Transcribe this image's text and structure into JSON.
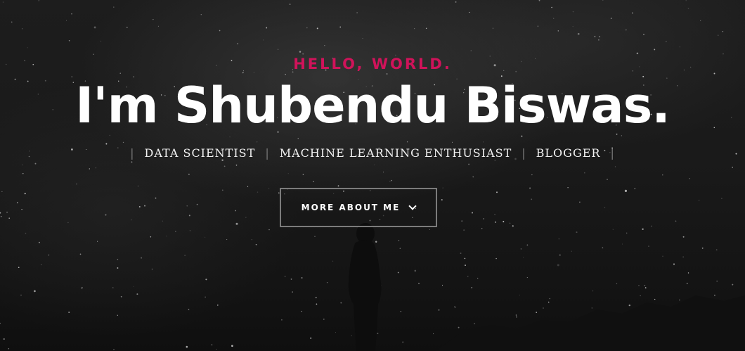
{
  "hero": {
    "kicker": "HELLO, WORLD.",
    "headline": "I'm Shubendu Biswas.",
    "roles": [
      "DATA SCIENTIST",
      "MACHINE LEARNING ENTHUSIAST",
      "BLOGGER"
    ],
    "separator": "|",
    "cta_label": "MORE ABOUT ME",
    "cta_icon": "chevron-down-icon"
  },
  "colors": {
    "accent": "#d0135a",
    "text": "#ffffff",
    "button_border": "#7b7b7b",
    "background": "#151515"
  }
}
